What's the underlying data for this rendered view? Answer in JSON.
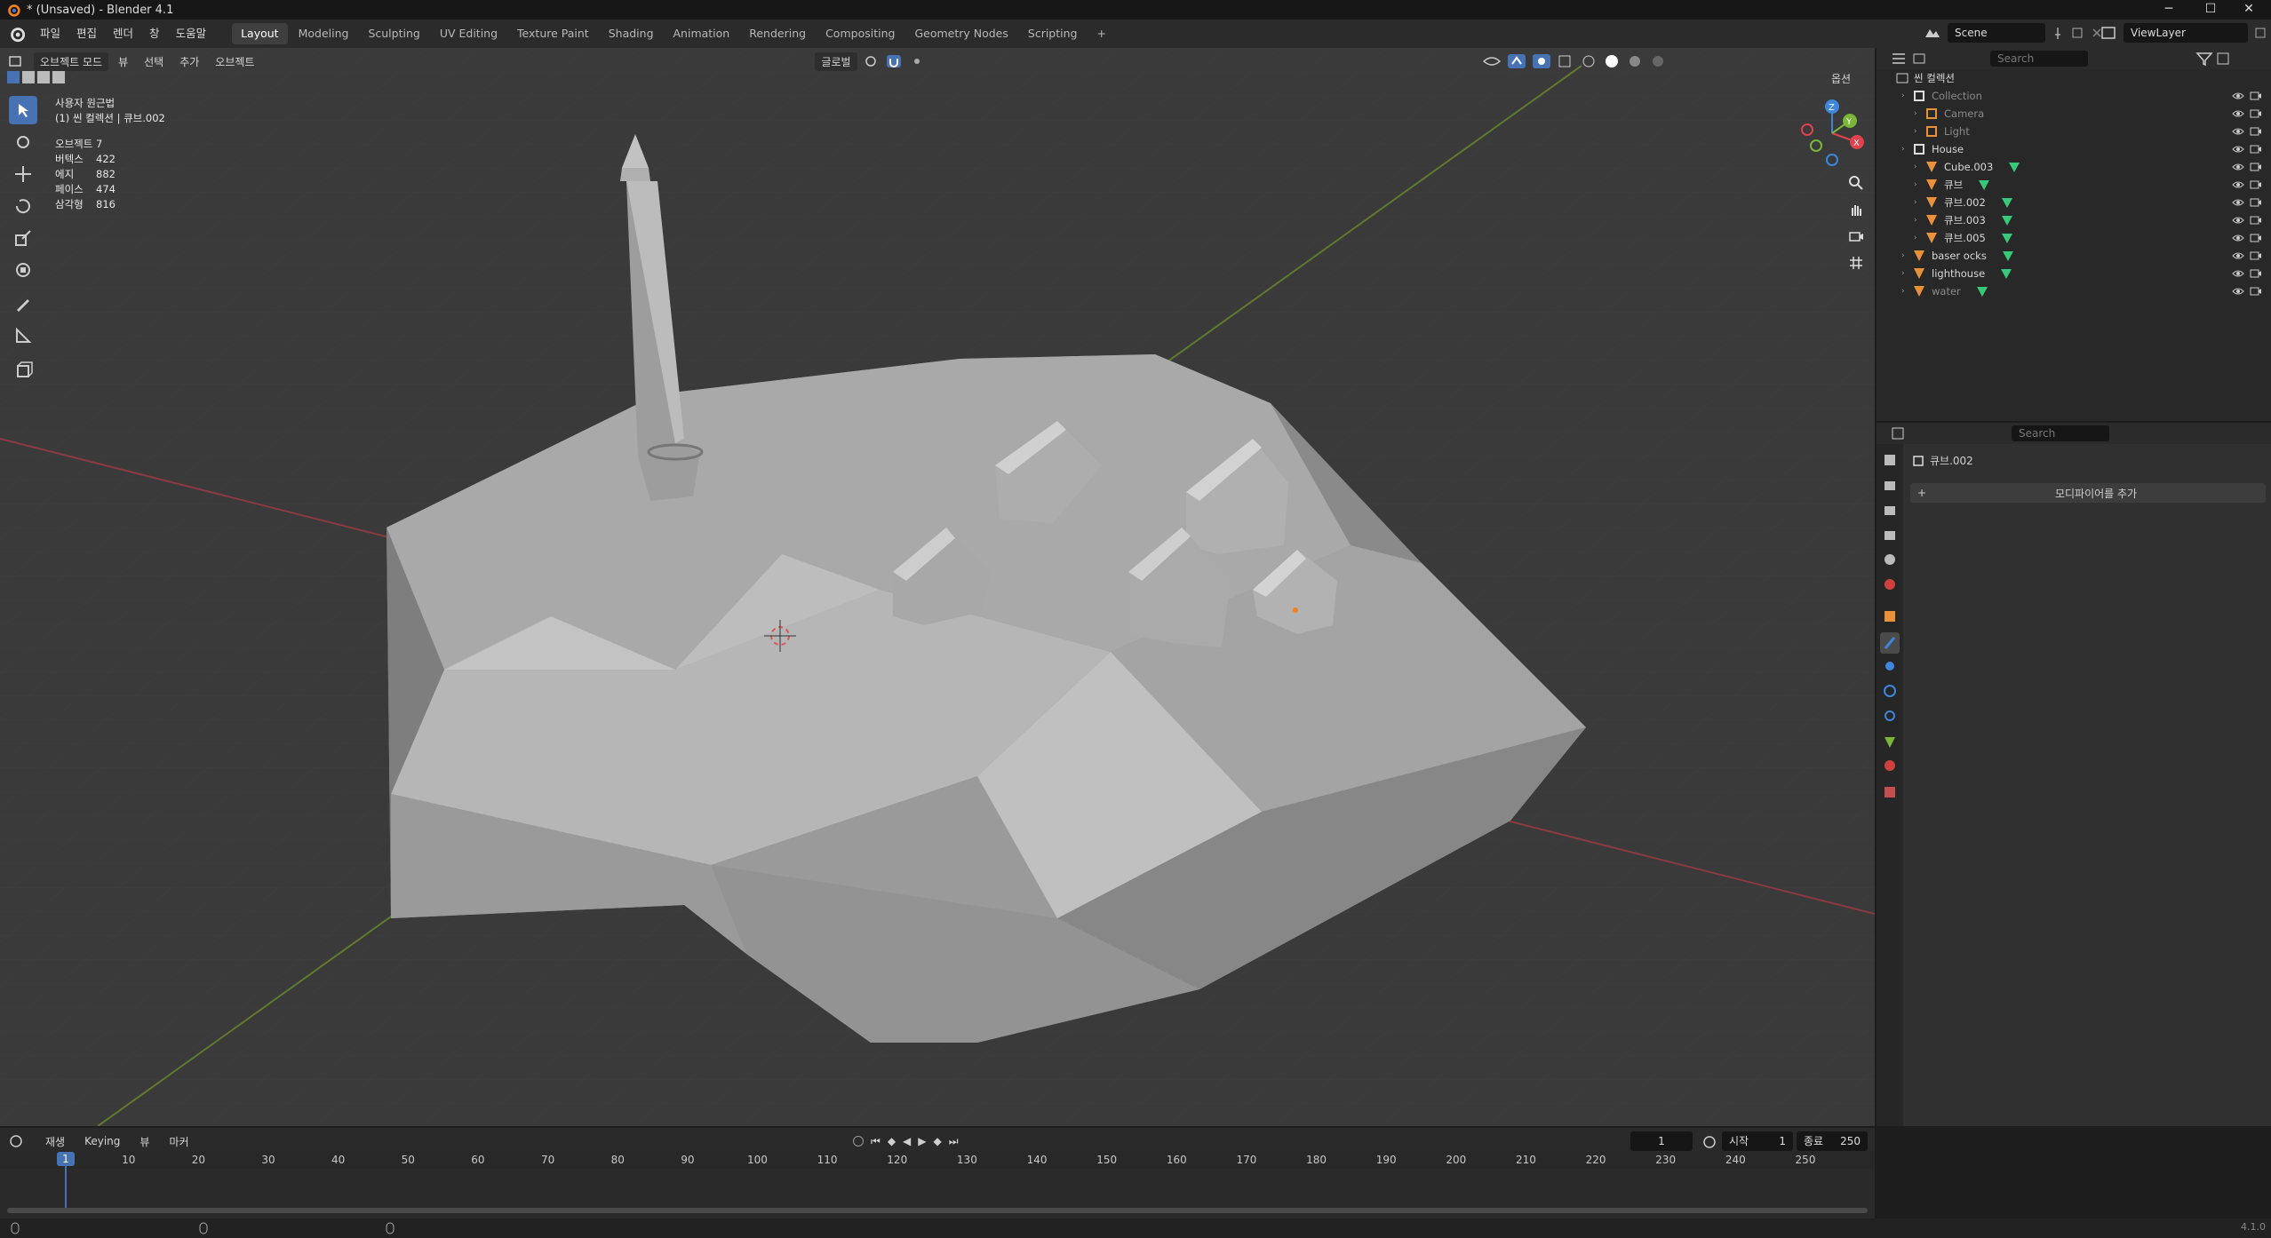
{
  "window": {
    "title": "* (Unsaved) - Blender 4.1",
    "min": "─",
    "max": "☐",
    "close": "✕"
  },
  "menubar": {
    "menus": [
      "파일",
      "편집",
      "렌더",
      "창",
      "도움말"
    ],
    "workspaces": [
      "Layout",
      "Modeling",
      "Sculpting",
      "UV Editing",
      "Texture Paint",
      "Shading",
      "Animation",
      "Rendering",
      "Compositing",
      "Geometry Nodes",
      "Scripting"
    ],
    "add_tab": "+",
    "scene": "Scene",
    "view_layer": "ViewLayer"
  },
  "viewport_header": {
    "mode": "오브젝트 모드",
    "menus": [
      "뷰",
      "선택",
      "추가",
      "오브젝트"
    ],
    "transform_orientation": "글로벌",
    "options_label": "옵션"
  },
  "stats": {
    "view_name": "사용자 원근법",
    "context": "(1) 씬 컬렉션 | 큐브.002",
    "rows": [
      {
        "k": "오브젝트",
        "v": "7"
      },
      {
        "k": "버텍스",
        "v": "422"
      },
      {
        "k": "에지",
        "v": "882"
      },
      {
        "k": "페이스",
        "v": "474"
      },
      {
        "k": "삼각형",
        "v": "816"
      }
    ]
  },
  "gizmo": {
    "x": "X",
    "y": "Y",
    "z": "Z"
  },
  "outliner": {
    "search_placeholder": "Search",
    "root": "씬 컬렉션",
    "items": [
      {
        "label": "Collection",
        "indent": 1,
        "type": "collection",
        "muted": true
      },
      {
        "label": "Camera",
        "indent": 2,
        "type": "camera",
        "muted": true
      },
      {
        "label": "Light",
        "indent": 2,
        "type": "light",
        "muted": true
      },
      {
        "label": "House",
        "indent": 1,
        "type": "collection",
        "muted": false
      },
      {
        "label": "Cube.003",
        "indent": 2,
        "type": "mesh",
        "muted": false
      },
      {
        "label": "큐브",
        "indent": 2,
        "type": "mesh",
        "muted": false
      },
      {
        "label": "큐브.002",
        "indent": 2,
        "type": "mesh",
        "muted": false
      },
      {
        "label": "큐브.003",
        "indent": 2,
        "type": "mesh",
        "muted": false
      },
      {
        "label": "큐브.005",
        "indent": 2,
        "type": "mesh",
        "muted": false
      },
      {
        "label": "baser ocks",
        "indent": 1,
        "type": "mesh",
        "muted": false
      },
      {
        "label": "lighthouse",
        "indent": 1,
        "type": "mesh",
        "muted": false
      },
      {
        "label": "water",
        "indent": 1,
        "type": "mesh",
        "muted": true
      }
    ]
  },
  "properties": {
    "search_placeholder": "Search",
    "object_name": "큐브.002",
    "add_modifier": "모디파이어를 추가"
  },
  "timeline": {
    "playback": "재생",
    "keying": "Keying",
    "view": "뷰",
    "marker": "마커",
    "current_frame": "1",
    "start_label": "시작",
    "start": "1",
    "end_label": "종료",
    "end": "250",
    "ticks": [
      "1",
      "10",
      "20",
      "30",
      "40",
      "50",
      "60",
      "70",
      "80",
      "90",
      "100",
      "110",
      "120",
      "130",
      "140",
      "150",
      "160",
      "170",
      "180",
      "190",
      "200",
      "210",
      "220",
      "230",
      "240",
      "250"
    ]
  },
  "status": {
    "version": "4.1.0"
  },
  "colors": {
    "accent": "#4772b3",
    "x_axis": "#e0424e",
    "y_axis": "#79b63a",
    "z_axis": "#3f86db",
    "mesh_icon": "#e8913a"
  }
}
